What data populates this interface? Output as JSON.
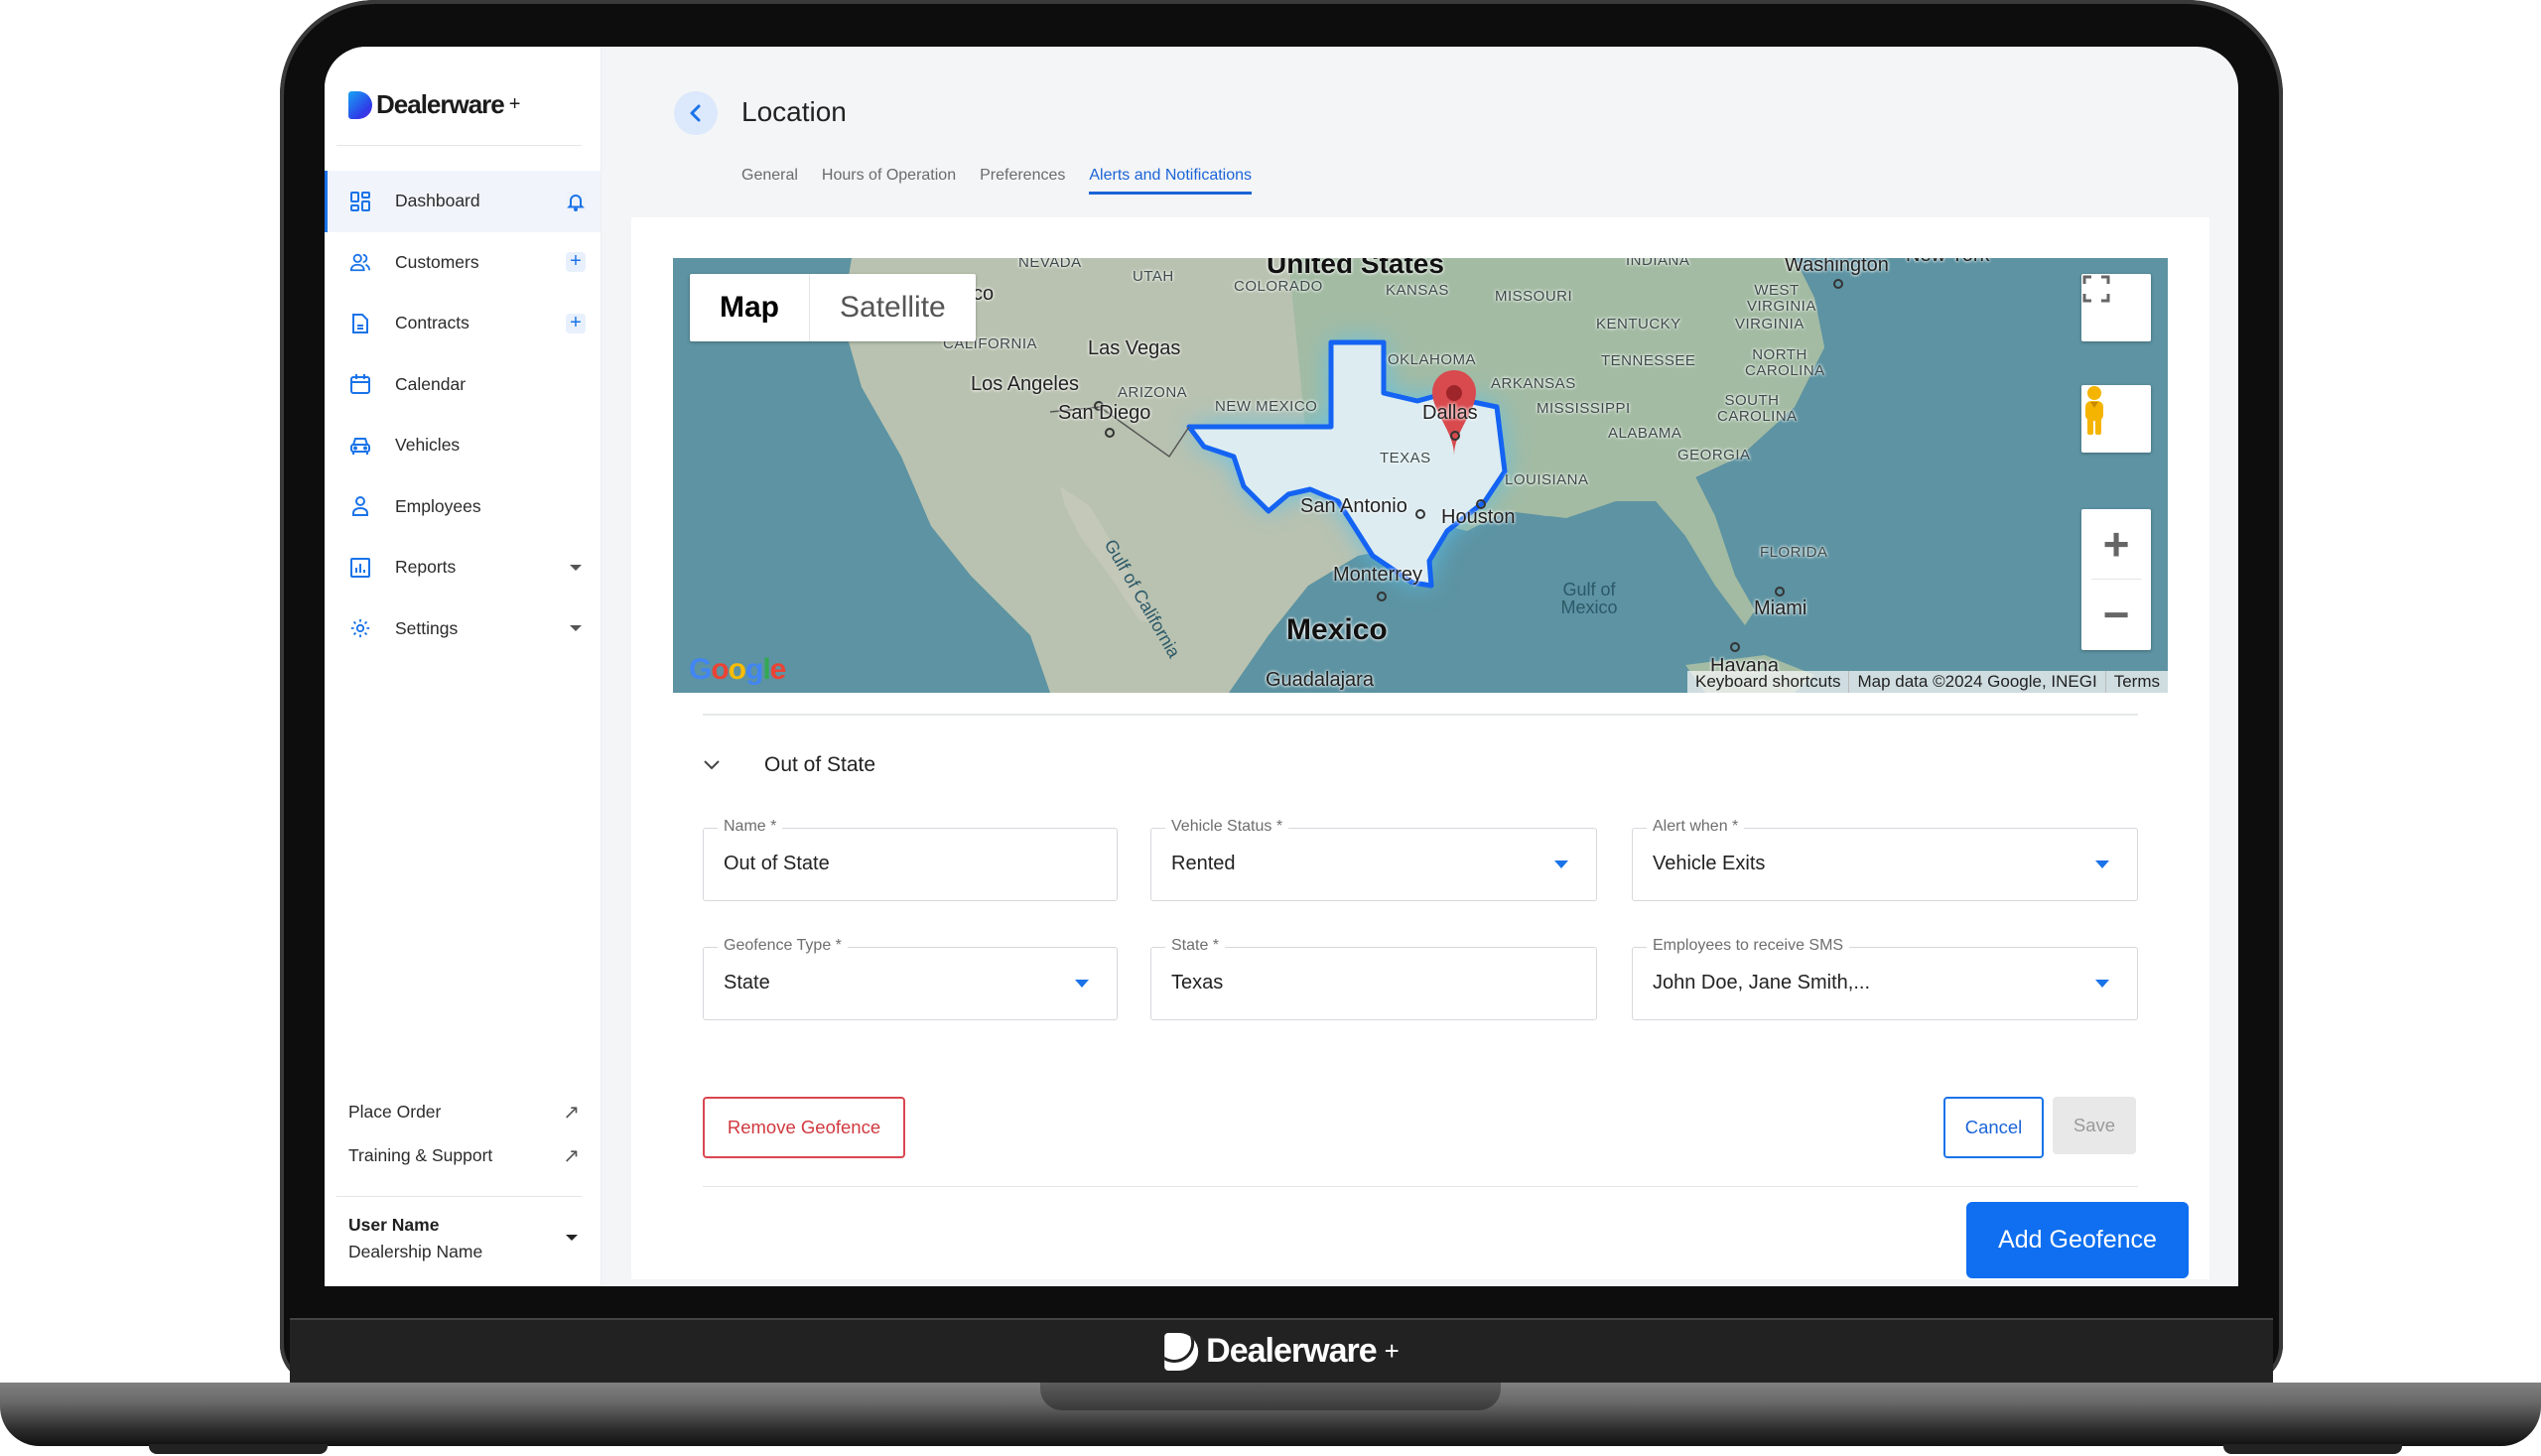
{
  "app": {
    "brand": "Dealerware",
    "brand_suffix": "+"
  },
  "sidebar": {
    "items": [
      {
        "label": "Dashboard",
        "icon": "dashboard-icon",
        "action": "bell-icon",
        "active": true
      },
      {
        "label": "Customers",
        "icon": "customers-icon",
        "action": "plus-icon"
      },
      {
        "label": "Contracts",
        "icon": "contract-icon",
        "action": "plus-icon"
      },
      {
        "label": "Calendar",
        "icon": "calendar-icon"
      },
      {
        "label": "Vehicles",
        "icon": "car-icon"
      },
      {
        "label": "Employees",
        "icon": "employee-icon"
      },
      {
        "label": "Reports",
        "icon": "reports-icon",
        "action": "caret-down-icon"
      },
      {
        "label": "Settings",
        "icon": "gear-icon",
        "action": "caret-down-icon"
      }
    ],
    "plus_glyph": "+",
    "links": [
      {
        "label": "Place Order",
        "icon": "external-link-icon",
        "glyph": "↗"
      },
      {
        "label": "Training & Support",
        "icon": "external-link-icon",
        "glyph": "↗"
      }
    ],
    "user": {
      "name": "User Name",
      "dealership": "Dealership Name"
    }
  },
  "header": {
    "title": "Location",
    "back_icon": "chevron-left-icon",
    "tabs": [
      {
        "label": "General",
        "active": false
      },
      {
        "label": "Hours of Operation",
        "active": false
      },
      {
        "label": "Preferences",
        "active": false
      },
      {
        "label": "Alerts and Notifications",
        "active": true
      }
    ]
  },
  "map": {
    "type_options": [
      "Map",
      "Satellite"
    ],
    "selected_type": "Map",
    "logo": "Google",
    "attribution": [
      "Keyboard shortcuts",
      "Map data ©2024 Google, INEGI",
      "Terms"
    ],
    "zoom_in": "+",
    "zoom_out": "−",
    "highlighted_region": "Texas",
    "labels": {
      "countries": [
        "United States",
        "Mexico"
      ],
      "states": [
        "NEVADA",
        "UTAH",
        "COLORADO",
        "KANSAS",
        "MISSOURI",
        "INDIANA",
        "WEST VIRGINIA",
        "KENTUCKY",
        "VIRGINIA",
        "CALIFORNIA",
        "ARIZONA",
        "NEW MEXICO",
        "OKLAHOMA",
        "ARKANSAS",
        "TENNESSEE",
        "NORTH CAROLINA",
        "SOUTH CAROLINA",
        "MISSISSIPPI",
        "ALABAMA",
        "GEORGIA",
        "LOUISIANA",
        "FLORIDA",
        "TEXAS"
      ],
      "cities": [
        "Las Vegas",
        "Los Angeles",
        "San Diego",
        "Dallas",
        "San Antonio",
        "Houston",
        "Monterrey",
        "Guadalajara",
        "Miami",
        "Havana",
        "Washington",
        "New York",
        "sco"
      ],
      "water": [
        "Gulf of California",
        "Gulf of Mexico"
      ]
    }
  },
  "geofence": {
    "section_title": "Out of State",
    "fields": {
      "name": {
        "label": "Name *",
        "value": "Out of State"
      },
      "vehicle_status": {
        "label": "Vehicle Status *",
        "value": "Rented"
      },
      "alert_when": {
        "label": "Alert when *",
        "value": "Vehicle Exits"
      },
      "geofence_type": {
        "label": "Geofence Type *",
        "value": "State"
      },
      "state": {
        "label": "State *",
        "value": "Texas"
      },
      "employees_sms": {
        "label": "Employees to receive SMS",
        "value": "John Doe, Jane Smith,..."
      }
    },
    "remove_label": "Remove Geofence",
    "cancel_label": "Cancel",
    "save_label": "Save",
    "add_label": "Add Geofence"
  },
  "colors": {
    "accent": "#1a73e8",
    "danger": "#d9474f",
    "primary_button": "#0f6ff0",
    "geofence_outline": "#1463f3"
  }
}
